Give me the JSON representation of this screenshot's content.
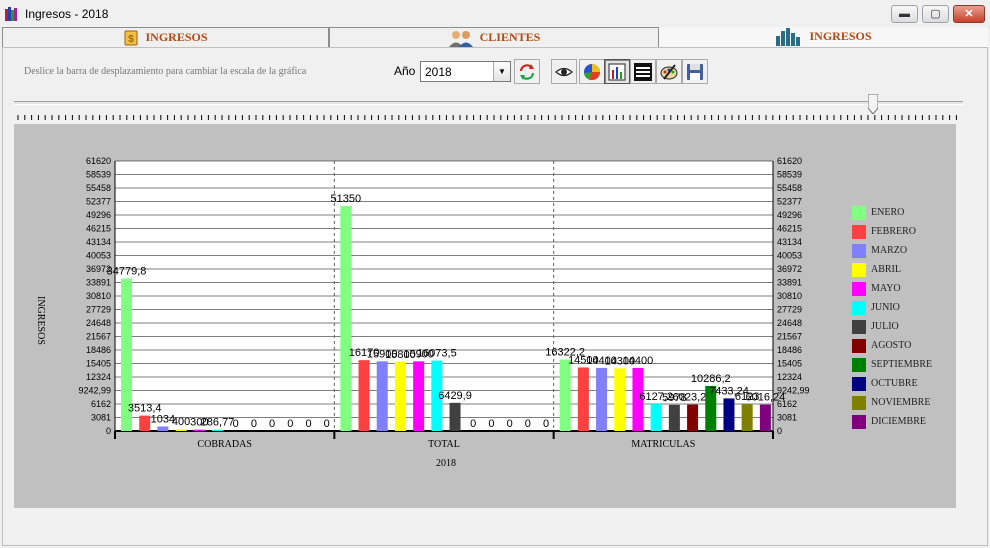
{
  "window": {
    "title": "Ingresos - 2018",
    "buttons": {
      "minimize": "▬",
      "maximize": "▢",
      "close": "✕"
    }
  },
  "tabs": [
    {
      "label": "INGRESOS",
      "icon": "money-bill-icon",
      "active": false
    },
    {
      "label": "CLIENTES",
      "icon": "users-icon",
      "active": false
    },
    {
      "label": "INGRESOS",
      "icon": "bar-chart-icon",
      "active": true
    }
  ],
  "toolbar": {
    "hint": "Deslice la barra de desplazamiento para cambiar la escala de la gráfica",
    "year_label": "Año",
    "year_value": "2018",
    "buttons": [
      "refresh-icon",
      "eye-icon",
      "pie-chart-icon",
      "bar-chart-icon",
      "lines-icon",
      "palette-icon",
      "save-icon"
    ]
  },
  "slider": {
    "value_fraction": 0.905
  },
  "colors": {
    "ENERO": "#80ff80",
    "FEBRERO": "#ff4040",
    "MARZO": "#8080ff",
    "ABRIL": "#ffff00",
    "MAYO": "#ff00ff",
    "JUNIO": "#00ffff",
    "JULIO": "#404040",
    "AGOSTO": "#800000",
    "SEPTIEMBRE": "#008000",
    "OCTUBRE": "#000080",
    "NOVIEMBRE": "#808000",
    "DICIEMBRE": "#800080"
  },
  "chart_data": {
    "type": "bar",
    "ylabel": "INGRESOS",
    "xlabel": "2018",
    "yticks": [
      "61620",
      "58539",
      "55458",
      "52377",
      "49296",
      "46215",
      "43134",
      "40053",
      "36972",
      "33891",
      "30810",
      "27729",
      "24648",
      "21567",
      "18486",
      "15405",
      "12324",
      "9242,99",
      "6162",
      "3081",
      "0"
    ],
    "ylim": [
      0,
      61620
    ],
    "categories": [
      "COBRADAS",
      "TOTAL",
      "MATRICULAS"
    ],
    "legend": [
      "ENERO",
      "FEBRERO",
      "MARZO",
      "ABRIL",
      "MAYO",
      "JUNIO",
      "JULIO",
      "AGOSTO",
      "SEPTIEMBRE",
      "OCTUBRE",
      "NOVIEMBRE",
      "DICIEMBRE"
    ],
    "legend_position": "right",
    "grid": true,
    "series": [
      {
        "name": "ENERO",
        "values": [
          34779.8,
          51350,
          16322.2
        ],
        "labels": [
          "34779,8",
          "51350",
          "16322,2"
        ]
      },
      {
        "name": "FEBRERO",
        "values": [
          3513.4,
          16170,
          14500
        ],
        "labels": [
          "3513,4",
          "16170",
          "14500"
        ]
      },
      {
        "name": "MARZO",
        "values": [
          1034,
          15900,
          14400
        ],
        "labels": [
          "1034",
          "15900",
          "14400"
        ]
      },
      {
        "name": "ABRIL",
        "values": [
          400,
          15800,
          14300
        ],
        "labels": [
          "400",
          "15800",
          "14300"
        ]
      },
      {
        "name": "MAYO",
        "values": [
          300,
          15900,
          14400
        ],
        "labels": [
          "300",
          "15900",
          "14400"
        ]
      },
      {
        "name": "JUNIO",
        "values": [
          286.77,
          16073.5,
          6127.2
        ],
        "labels": [
          "286,77",
          "16073,5",
          "6127,2"
        ]
      },
      {
        "name": "JULIO",
        "values": [
          0,
          6429.9,
          5978
        ],
        "labels": [
          "0",
          "6429,9",
          "5978"
        ]
      },
      {
        "name": "AGOSTO",
        "values": [
          0,
          0,
          6023.24
        ],
        "labels": [
          "0",
          "0",
          "6023,24"
        ]
      },
      {
        "name": "SEPTIEMBRE",
        "values": [
          0,
          0,
          10286.2
        ],
        "labels": [
          "0",
          "0",
          "10286,2"
        ]
      },
      {
        "name": "OCTUBRE",
        "values": [
          0,
          0,
          7433.24
        ],
        "labels": [
          "0",
          "0",
          "7433,24"
        ]
      },
      {
        "name": "NOVIEMBRE",
        "values": [
          0,
          0,
          6123
        ],
        "labels": [
          "0",
          "0",
          "6123"
        ]
      },
      {
        "name": "DICIEMBRE",
        "values": [
          0,
          0,
          6016.24
        ],
        "labels": [
          "0",
          "0",
          "6016,24"
        ]
      }
    ]
  }
}
